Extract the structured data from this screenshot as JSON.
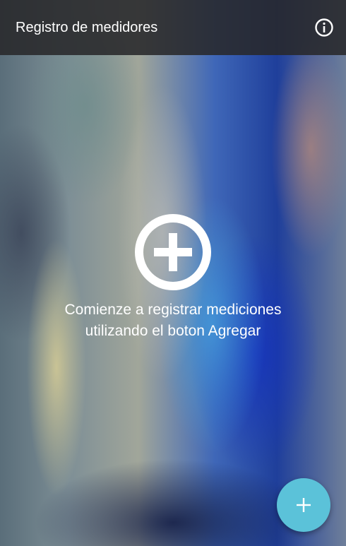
{
  "appbar": {
    "title": "Registro de medidores",
    "info_icon": "info-icon"
  },
  "empty_state": {
    "icon": "add-circle-icon",
    "line1": "Comienze a registrar mediciones",
    "line2": "utilizando el boton Agregar"
  },
  "fab": {
    "icon": "plus-icon",
    "color": "#5bc2d9"
  }
}
